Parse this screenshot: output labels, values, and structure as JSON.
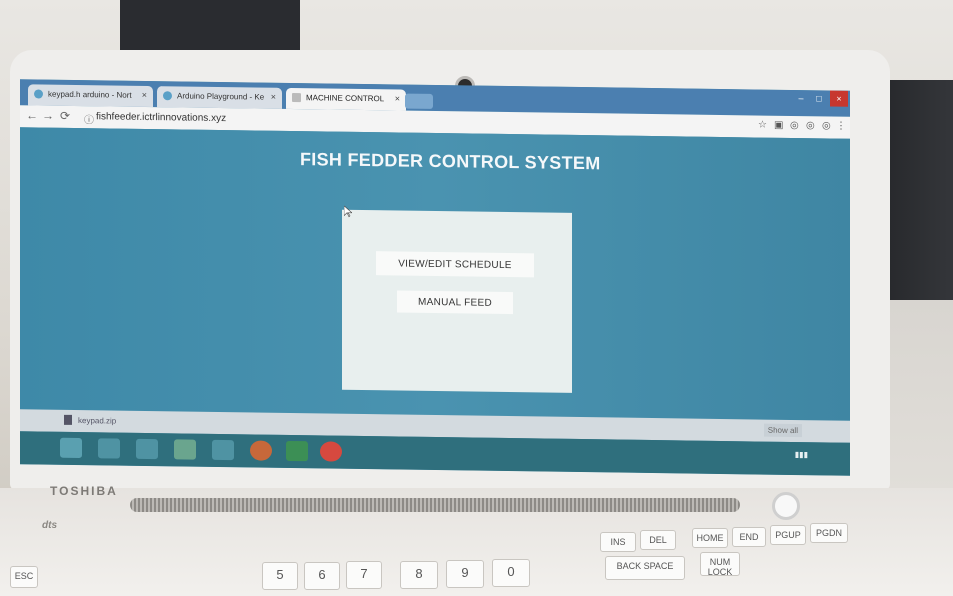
{
  "browser": {
    "tabs": [
      {
        "label": "keypad.h arduino - Nort"
      },
      {
        "label": "Arduino Playground - Ke"
      },
      {
        "label": "MACHINE CONTROL"
      }
    ],
    "url": "fishfeeder.ictrlinnovations.xyz"
  },
  "page": {
    "title": "FISH FEDDER CONTROL SYSTEM",
    "buttons": {
      "schedule": "VIEW/EDIT SCHEDULE",
      "manual_feed": "MANUAL FEED"
    }
  },
  "download_bar": {
    "file": "keypad.zip",
    "show_all": "Show all"
  },
  "laptop": {
    "brand": "TOSHIBA",
    "audio_logo": "dts",
    "keys": [
      "ESC",
      "DEL",
      "HOME",
      "END",
      "PGUP",
      "PGDN",
      "INS",
      "BACK SPACE",
      "NUM LOCK",
      "5",
      "6",
      "7",
      "8",
      "9",
      "0"
    ]
  },
  "colors": {
    "page_bg": "#3f8aa6",
    "panel_bg": "#e8efee",
    "tab_bar": "#4b7fb0"
  }
}
